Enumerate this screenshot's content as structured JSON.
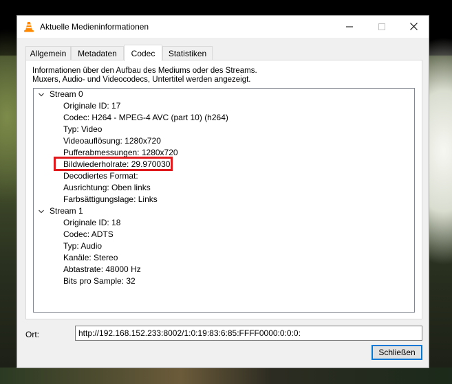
{
  "window": {
    "title": "Aktuelle Medieninformationen",
    "controls": {
      "minimize": "—",
      "maximize": "☐",
      "close": "✕"
    }
  },
  "tabs": [
    {
      "label": "Allgemein",
      "active": false
    },
    {
      "label": "Metadaten",
      "active": false
    },
    {
      "label": "Codec",
      "active": true
    },
    {
      "label": "Statistiken",
      "active": false
    }
  ],
  "description": {
    "line1": "Informationen über den Aufbau des Mediums oder des Streams.",
    "line2": "Muxers, Audio- und Videocodecs, Untertitel werden angezeigt."
  },
  "tree": {
    "stream0": {
      "label": "Stream 0",
      "items": [
        "Originale ID: 17",
        "Codec: H264 - MPEG-4 AVC (part 10) (h264)",
        "Typ: Video",
        "Videoauflösung: 1280x720",
        "Pufferabmessungen: 1280x720",
        "Bildwiederholrate: 29.970030",
        "Decodiertes Format:",
        "Ausrichtung: Oben links",
        "Farbsättigungslage: Links"
      ]
    },
    "stream1": {
      "label": "Stream 1",
      "items": [
        "Originale ID: 18",
        "Codec: ADTS",
        "Typ: Audio",
        "Kanäle: Stereo",
        "Abtastrate: 48000 Hz",
        "Bits pro Sample: 32"
      ]
    }
  },
  "location": {
    "label": "Ort:",
    "value": "http://192.168.152.233:8002/1:0:19:83:6:85:FFFF0000:0:0:0:"
  },
  "buttons": {
    "close": "Schließen"
  },
  "colors": {
    "highlight": "#e0191c",
    "focus": "#0078d7"
  }
}
